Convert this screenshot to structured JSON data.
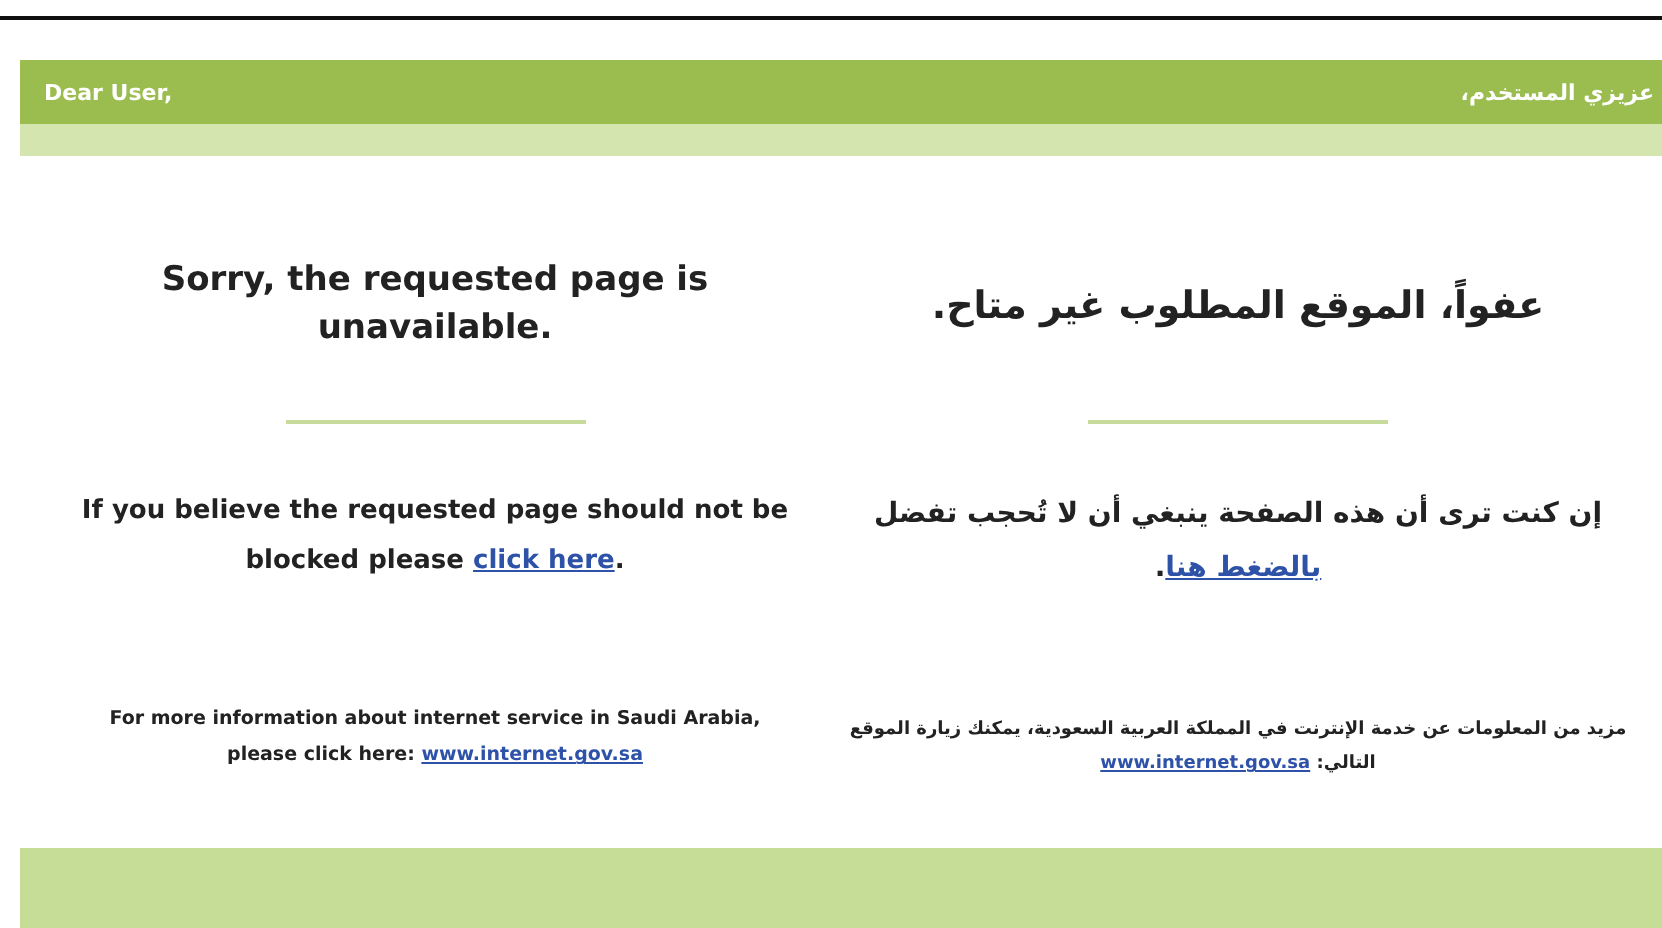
{
  "header": {
    "greeting_en": "Dear User,",
    "greeting_ar": "عزيزي المستخدم،"
  },
  "english": {
    "title": "Sorry, the requested page is unavailable.",
    "message": {
      "before": "If you believe the requested page should not be blocked please ",
      "link": "click here",
      "after": "."
    },
    "info": {
      "before": "For more information about internet service in Saudi Arabia, please click here: ",
      "link": "www.internet.gov.sa"
    }
  },
  "arabic": {
    "title": "عفواً، الموقع المطلوب غير متاح.",
    "message": {
      "before": "إن كنت ترى أن هذه الصفحة ينبغي أن لا تُحجب تفضل ",
      "link": "بالضغط هنا",
      "after": "."
    },
    "info": {
      "before": "مزيد من المعلومات عن خدمة الإنترنت في المملكة العربية السعودية، يمكنك زيارة الموقع التالي: ",
      "link": "www.internet.gov.sa"
    }
  }
}
